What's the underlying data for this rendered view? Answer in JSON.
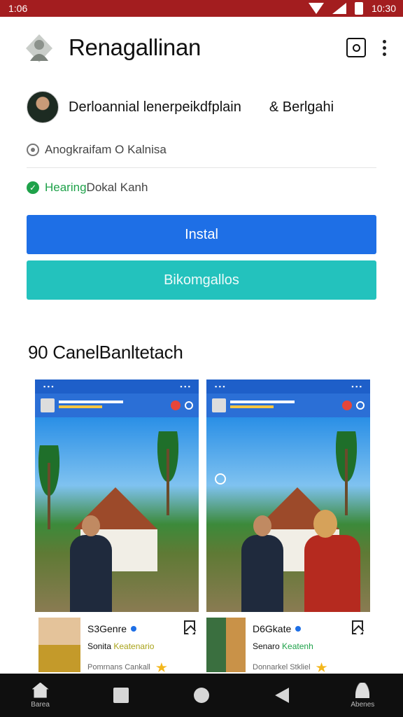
{
  "status_bar": {
    "time": "1:06",
    "clock_right": "10:30"
  },
  "app_bar": {
    "title": "Renagallinan"
  },
  "developer": {
    "name": "Derloannial lenerpeikdfplain",
    "extra": "& Berlgahi"
  },
  "meta": {
    "line1": "Anogkraifam O Kalnisa",
    "line2_highlight": "Hearing",
    "line2_rest": " Dokal Kanh"
  },
  "buttons": {
    "install": "Instal",
    "secondary": "Bikomgallos"
  },
  "screenshots_title": "90 CanelBanltetach",
  "cards": [
    {
      "name": "S3Genre",
      "sub_prefix": "Sonita ",
      "sub_highlight": "Keatenario",
      "footer": "Pomrnans Cankall"
    },
    {
      "name": "D6Gkate",
      "sub_prefix": "Senaro ",
      "sub_highlight": "Keatenh",
      "footer": "Donnarkel Stkliel"
    }
  ],
  "nav": {
    "home_label": "Barea",
    "profile_label": "Abenes"
  },
  "colors": {
    "status_bar": "#a31d1f",
    "install": "#1e6fe6",
    "secondary": "#23c2bd",
    "verified": "#1fa24a"
  },
  "icons": [
    "logo-icon",
    "camera-icon",
    "more-vert-icon",
    "radio-icon",
    "check-circle-icon",
    "verified-icon",
    "bookmark-icon",
    "star-icon",
    "home-icon",
    "square-icon",
    "circle-icon",
    "back-icon",
    "profile-icon"
  ]
}
